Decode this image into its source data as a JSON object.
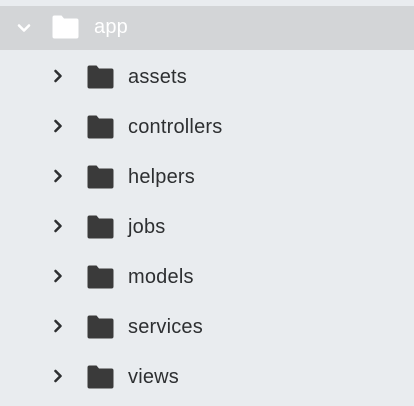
{
  "tree": {
    "root": {
      "label": "app",
      "expanded": true,
      "icon": "folder-icon",
      "chevron": "chevron-down-icon"
    },
    "children": [
      {
        "label": "assets",
        "icon": "folder-icon",
        "chevron": "chevron-right-icon",
        "expanded": false
      },
      {
        "label": "controllers",
        "icon": "folder-icon",
        "chevron": "chevron-right-icon",
        "expanded": false
      },
      {
        "label": "helpers",
        "icon": "folder-icon",
        "chevron": "chevron-right-icon",
        "expanded": false
      },
      {
        "label": "jobs",
        "icon": "folder-icon",
        "chevron": "chevron-right-icon",
        "expanded": false
      },
      {
        "label": "models",
        "icon": "folder-icon",
        "chevron": "chevron-right-icon",
        "expanded": false
      },
      {
        "label": "services",
        "icon": "folder-icon",
        "chevron": "chevron-right-icon",
        "expanded": false
      },
      {
        "label": "views",
        "icon": "folder-icon",
        "chevron": "chevron-right-icon",
        "expanded": false
      }
    ]
  },
  "colors": {
    "background": "#e9ecef",
    "selected_row": "#d3d5d7",
    "root_folder": "#ffffff",
    "child_folder": "#3a3a3a",
    "child_text": "#2d2f31"
  }
}
